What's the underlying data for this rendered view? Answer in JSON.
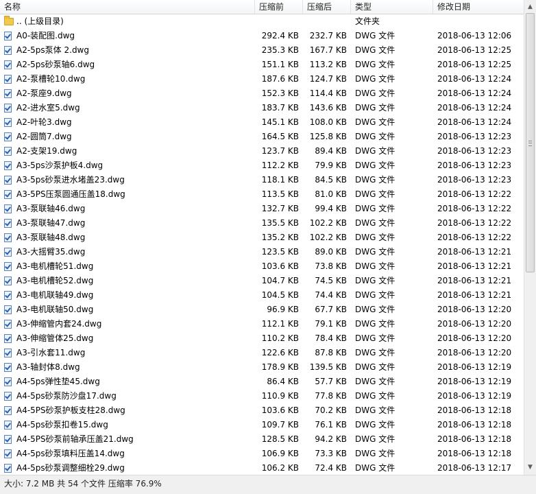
{
  "columns": {
    "name": "名称",
    "before": "压缩前",
    "after": "压缩后",
    "type": "类型",
    "date": "修改日期"
  },
  "parent_row": {
    "name": ".. (上级目录)",
    "type": "文件夹"
  },
  "files": [
    {
      "name": "A0-装配图.dwg",
      "before": "292.4 KB",
      "after": "232.7 KB",
      "type": "DWG 文件",
      "date": "2018-06-13 12:06"
    },
    {
      "name": "A2-5ps泵体 2.dwg",
      "before": "235.3 KB",
      "after": "167.7 KB",
      "type": "DWG 文件",
      "date": "2018-06-13 12:25"
    },
    {
      "name": "A2-5ps砂泵轴6.dwg",
      "before": "151.1 KB",
      "after": "113.2 KB",
      "type": "DWG 文件",
      "date": "2018-06-13 12:25"
    },
    {
      "name": "A2-泵槽轮10.dwg",
      "before": "187.6 KB",
      "after": "124.7 KB",
      "type": "DWG 文件",
      "date": "2018-06-13 12:24"
    },
    {
      "name": "A2-泵座9.dwg",
      "before": "152.3 KB",
      "after": "114.4 KB",
      "type": "DWG 文件",
      "date": "2018-06-13 12:24"
    },
    {
      "name": "A2-进水室5.dwg",
      "before": "183.7 KB",
      "after": "143.6 KB",
      "type": "DWG 文件",
      "date": "2018-06-13 12:24"
    },
    {
      "name": "A2-叶轮3.dwg",
      "before": "145.1 KB",
      "after": "108.0 KB",
      "type": "DWG 文件",
      "date": "2018-06-13 12:24"
    },
    {
      "name": "A2-圆筒7.dwg",
      "before": "164.5 KB",
      "after": "125.8 KB",
      "type": "DWG 文件",
      "date": "2018-06-13 12:23"
    },
    {
      "name": "A2-支架19.dwg",
      "before": "123.7 KB",
      "after": "89.4 KB",
      "type": "DWG 文件",
      "date": "2018-06-13 12:23"
    },
    {
      "name": "A3-5ps沙泵护板4.dwg",
      "before": "112.2 KB",
      "after": "79.9 KB",
      "type": "DWG 文件",
      "date": "2018-06-13 12:23"
    },
    {
      "name": "A3-5ps砂泵进水堵盖23.dwg",
      "before": "118.1 KB",
      "after": "84.5 KB",
      "type": "DWG 文件",
      "date": "2018-06-13 12:23"
    },
    {
      "name": "A3-5PS压泵圆通压盖18.dwg",
      "before": "113.5 KB",
      "after": "81.0 KB",
      "type": "DWG 文件",
      "date": "2018-06-13 12:22"
    },
    {
      "name": "A3-泵联轴46.dwg",
      "before": "132.7 KB",
      "after": "99.4 KB",
      "type": "DWG 文件",
      "date": "2018-06-13 12:22"
    },
    {
      "name": "A3-泵联轴47.dwg",
      "before": "135.5 KB",
      "after": "102.2 KB",
      "type": "DWG 文件",
      "date": "2018-06-13 12:22"
    },
    {
      "name": "A3-泵联轴48.dwg",
      "before": "135.2 KB",
      "after": "102.2 KB",
      "type": "DWG 文件",
      "date": "2018-06-13 12:22"
    },
    {
      "name": "A3-大摇臂35.dwg",
      "before": "123.5 KB",
      "after": "89.0 KB",
      "type": "DWG 文件",
      "date": "2018-06-13 12:21"
    },
    {
      "name": "A3-电机槽轮51.dwg",
      "before": "103.6 KB",
      "after": "73.8 KB",
      "type": "DWG 文件",
      "date": "2018-06-13 12:21"
    },
    {
      "name": "A3-电机槽轮52.dwg",
      "before": "104.7 KB",
      "after": "74.5 KB",
      "type": "DWG 文件",
      "date": "2018-06-13 12:21"
    },
    {
      "name": "A3-电机联轴49.dwg",
      "before": "104.5 KB",
      "after": "74.4 KB",
      "type": "DWG 文件",
      "date": "2018-06-13 12:21"
    },
    {
      "name": "A3-电机联轴50.dwg",
      "before": "96.9 KB",
      "after": "67.7 KB",
      "type": "DWG 文件",
      "date": "2018-06-13 12:20"
    },
    {
      "name": "A3-伸缩管内套24.dwg",
      "before": "112.1 KB",
      "after": "79.1 KB",
      "type": "DWG 文件",
      "date": "2018-06-13 12:20"
    },
    {
      "name": "A3-伸缩管体25.dwg",
      "before": "110.2 KB",
      "after": "78.4 KB",
      "type": "DWG 文件",
      "date": "2018-06-13 12:20"
    },
    {
      "name": "A3-引水套11.dwg",
      "before": "122.6 KB",
      "after": "87.8 KB",
      "type": "DWG 文件",
      "date": "2018-06-13 12:20"
    },
    {
      "name": "A3-轴封体8.dwg",
      "before": "178.9 KB",
      "after": "139.5 KB",
      "type": "DWG 文件",
      "date": "2018-06-13 12:19"
    },
    {
      "name": "A4-5ps弹性垫45.dwg",
      "before": "86.4 KB",
      "after": "57.7 KB",
      "type": "DWG 文件",
      "date": "2018-06-13 12:19"
    },
    {
      "name": "A4-5ps砂泵防沙盘17.dwg",
      "before": "110.9 KB",
      "after": "77.8 KB",
      "type": "DWG 文件",
      "date": "2018-06-13 12:19"
    },
    {
      "name": "A4-5PS砂泵护板支柱28.dwg",
      "before": "103.6 KB",
      "after": "70.2 KB",
      "type": "DWG 文件",
      "date": "2018-06-13 12:18"
    },
    {
      "name": "A4-5ps砂泵扣卷15.dwg",
      "before": "109.7 KB",
      "after": "76.1 KB",
      "type": "DWG 文件",
      "date": "2018-06-13 12:18"
    },
    {
      "name": "A4-5PS砂泵前轴承压盖21.dwg",
      "before": "128.5 KB",
      "after": "94.2 KB",
      "type": "DWG 文件",
      "date": "2018-06-13 12:18"
    },
    {
      "name": "A4-5ps砂泵填料压盖14.dwg",
      "before": "106.9 KB",
      "after": "73.3 KB",
      "type": "DWG 文件",
      "date": "2018-06-13 12:18"
    },
    {
      "name": "A4-5ps砂泵调整细栓29.dwg",
      "before": "106.2 KB",
      "after": "72.4 KB",
      "type": "DWG 文件",
      "date": "2018-06-13 12:17"
    }
  ],
  "scroll": {
    "up_arrow": "▲",
    "down_arrow": "▼",
    "position_fraction": 0.0,
    "visible_fraction": 0.57
  },
  "status": {
    "text": "大小: 7.2 MB 共 54 个文件 压缩率 76.9%"
  },
  "colors": {
    "header_bg": "#f5f7fa",
    "status_bg": "#f0f0f0",
    "folder": "#f0c94d",
    "file_icon": "#2a62b8"
  }
}
